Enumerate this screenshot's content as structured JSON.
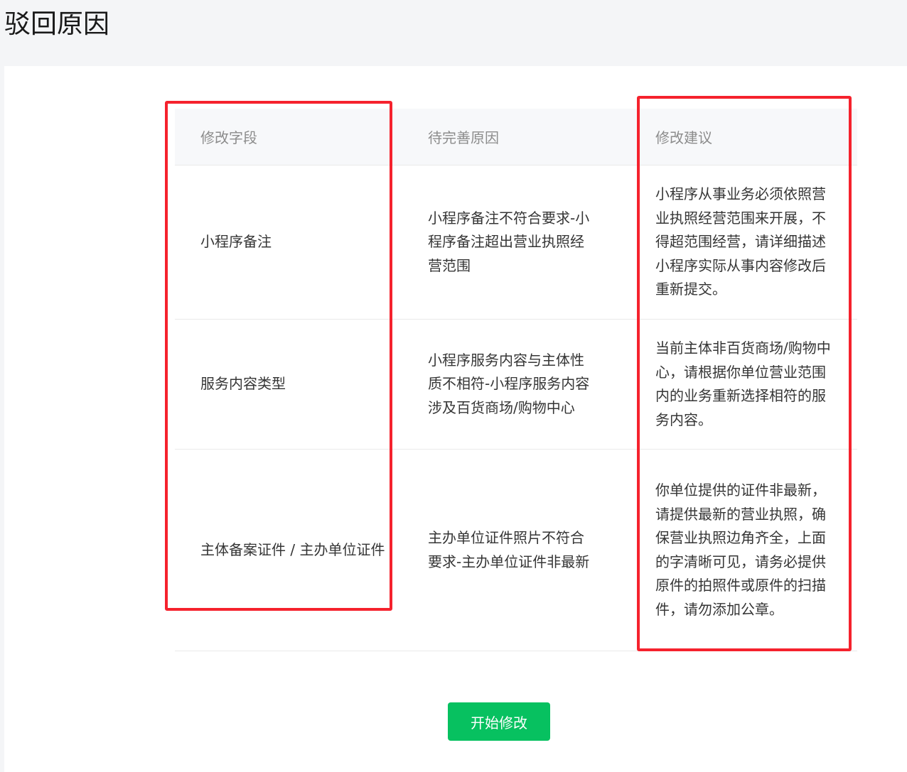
{
  "page": {
    "title": "驳回原因"
  },
  "table": {
    "headers": [
      "修改字段",
      "待完善原因",
      "修改建议"
    ],
    "rows": [
      {
        "field": "小程序备注",
        "reason": "小程序备注不符合要求-小程序备注超出营业执照经营范围",
        "suggestion": "小程序从事业务必须依照营业执照经营范围来开展，不得超范围经营，请详细描述小程序实际从事内容修改后重新提交。"
      },
      {
        "field": "服务内容类型",
        "reason": "小程序服务内容与主体性质不相符-小程序服务内容涉及百货商场/购物中心",
        "suggestion": "当前主体非百货商场/购物中心，请根据你单位营业范围内的业务重新选择相符的服务内容。"
      },
      {
        "field": "主体备案证件 / 主办单位证件",
        "reason": "主办单位证件照片不符合要求-主办单位证件非最新",
        "suggestion": "你单位提供的证件非最新，请提供最新的营业执照，确保营业执照边角齐全，上面的字清晰可见，请务必提供原件的拍照件或原件的扫描件，请勿添加公章。"
      }
    ]
  },
  "actions": {
    "start_label": "开始修改"
  },
  "colors": {
    "primary": "#07c160",
    "highlight": "#f5222d",
    "page_background": "#f4f5f7",
    "header_background": "#f7f8fa"
  }
}
